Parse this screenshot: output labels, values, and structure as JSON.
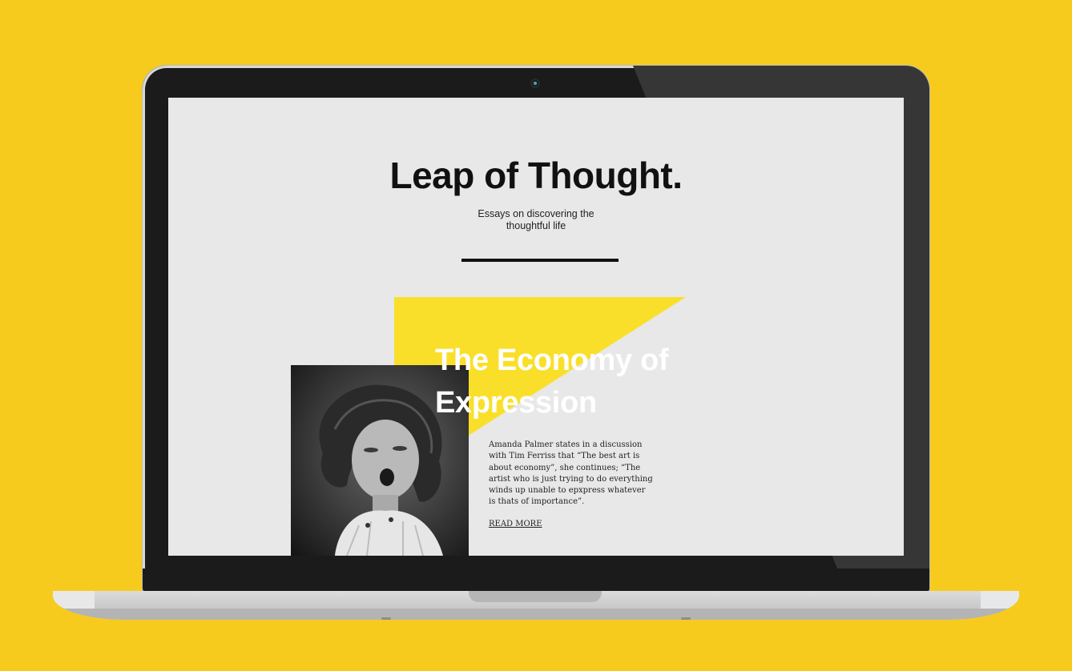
{
  "site": {
    "title": "Leap of Thought.",
    "tagline": "Essays on discovering the thoughtful life"
  },
  "article": {
    "title": "The Economy of Expression",
    "excerpt": "Amanda Palmer states in a discussion with Tim Ferriss that “The best art is about economy”, she continues; “The artist who is just trying to do everything winds up unable to epxpress whatever is thats of importance”.",
    "read_more": "READ MORE",
    "image": "black-and-white-photo-of-child-making-face"
  },
  "colors": {
    "background": "#F7CB1E",
    "accent": "#FADF2A",
    "screen": "#E8E8E8"
  }
}
